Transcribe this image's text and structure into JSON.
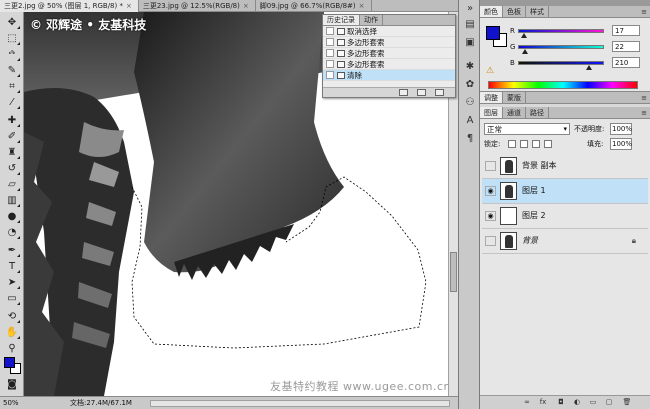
{
  "tabs": [
    {
      "label": "三更2.jpg @ 50% (图层 1, RGB/8) *",
      "active": true
    },
    {
      "label": "三更23.jpg @ 12.5%(RGB/8)",
      "active": false
    },
    {
      "label": "脚09.jpg @ 66.7%(RGB/8#)",
      "active": false
    }
  ],
  "close_glyph": "×",
  "watermark": "© 邓辉途 • 友基科技",
  "bottom_watermark": "友基特约教程 www.ugee.com.cn",
  "status": {
    "zoom": "50%",
    "doc": "文档:27.4M/67.1M"
  },
  "history": {
    "tabs": [
      "历史记录",
      "动作"
    ],
    "items": [
      "取消选择",
      "多边形套索",
      "多边形套索",
      "多边形套索",
      "清除"
    ],
    "selected_index": 4
  },
  "color_panel": {
    "tabs": [
      "颜色",
      "色板",
      "样式"
    ],
    "r": {
      "label": "R",
      "value": "17",
      "fraction": 0.067
    },
    "g": {
      "label": "G",
      "value": "22",
      "fraction": 0.086
    },
    "b": {
      "label": "B",
      "value": "210",
      "fraction": 0.824
    },
    "fg_color": "#1116d2"
  },
  "adj_panel": {
    "tabs": [
      "调整",
      "蒙版"
    ]
  },
  "layers_panel": {
    "tabs": [
      "图层",
      "通道",
      "路径"
    ],
    "blend_mode": "正常",
    "opacity_label": "不透明度:",
    "opacity_value": "100%",
    "lock_label": "锁定:",
    "fill_label": "填充:",
    "fill_value": "100%",
    "layers": [
      {
        "name": "背景 副本",
        "visible": false,
        "selected": false,
        "italic": false,
        "thumb": "figure",
        "locked": false
      },
      {
        "name": "图层 1",
        "visible": true,
        "selected": true,
        "italic": false,
        "thumb": "figure",
        "locked": false
      },
      {
        "name": "图层 2",
        "visible": true,
        "selected": false,
        "italic": false,
        "thumb": "blank",
        "locked": false
      },
      {
        "name": "背景",
        "visible": false,
        "selected": false,
        "italic": true,
        "thumb": "figure",
        "locked": true
      }
    ]
  }
}
